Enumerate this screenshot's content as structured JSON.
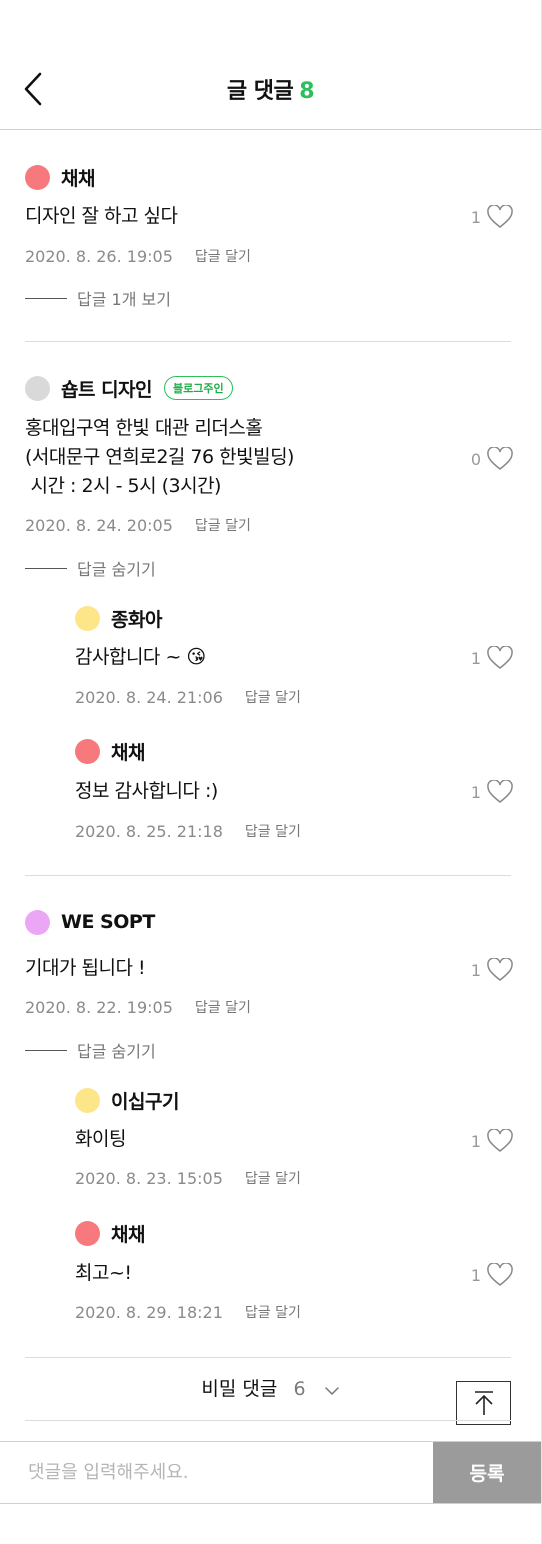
{
  "header": {
    "title": "글 댓글",
    "count": "8"
  },
  "colors": {
    "accent": "#2dbf5c",
    "avatar_red": "#f7797d",
    "avatar_gray": "#d9d9d9",
    "avatar_yellow": "#fde68a",
    "avatar_purple": "#eba6f5",
    "submit_bg": "#9b9b9b"
  },
  "reply_label": "답글 달기",
  "comments": [
    {
      "author": "채채",
      "avatar_color": "#f7797d",
      "text": "디자인 잘 하고 싶다",
      "likes": "1",
      "date": "2020. 8. 26. 19:05",
      "toggle": "답글 1개 보기"
    },
    {
      "author": "숍트 디자인",
      "avatar_color": "#d9d9d9",
      "badge": "블로그주인",
      "text": "홍대입구역 한빛 대관 리더스홀\n(서대문구 연희로2길 76 한빛빌딩)\n 시간 : 2시 - 5시 (3시간)",
      "likes": "0",
      "date": "2020. 8. 24. 20:05",
      "toggle": "답글 숨기기",
      "replies": [
        {
          "author": "종화아",
          "avatar_color": "#fde68a",
          "text": "감사합니다 ~ 😘",
          "likes": "1",
          "date": "2020. 8. 24. 21:06"
        },
        {
          "author": "채채",
          "avatar_color": "#f7797d",
          "text": "정보 감사합니다 :)",
          "likes": "1",
          "date": "2020. 8. 25. 21:18"
        }
      ]
    },
    {
      "author": "WE SOPT",
      "avatar_color": "#eba6f5",
      "text": "기대가 됩니다 !",
      "likes": "1",
      "date": "2020. 8. 22. 19:05",
      "toggle": "답글 숨기기",
      "replies": [
        {
          "author": "이십구기",
          "avatar_color": "#fde68a",
          "text": "화이팅",
          "likes": "1",
          "date": "2020. 8. 23. 15:05"
        },
        {
          "author": "채채",
          "avatar_color": "#f7797d",
          "text": "최고~!",
          "likes": "1",
          "date": "2020. 8. 29. 18:21"
        }
      ]
    }
  ],
  "secret": {
    "label": "비밀 댓글",
    "count": "6"
  },
  "input": {
    "placeholder": "댓글을 입력해주세요.",
    "submit_label": "등록"
  }
}
